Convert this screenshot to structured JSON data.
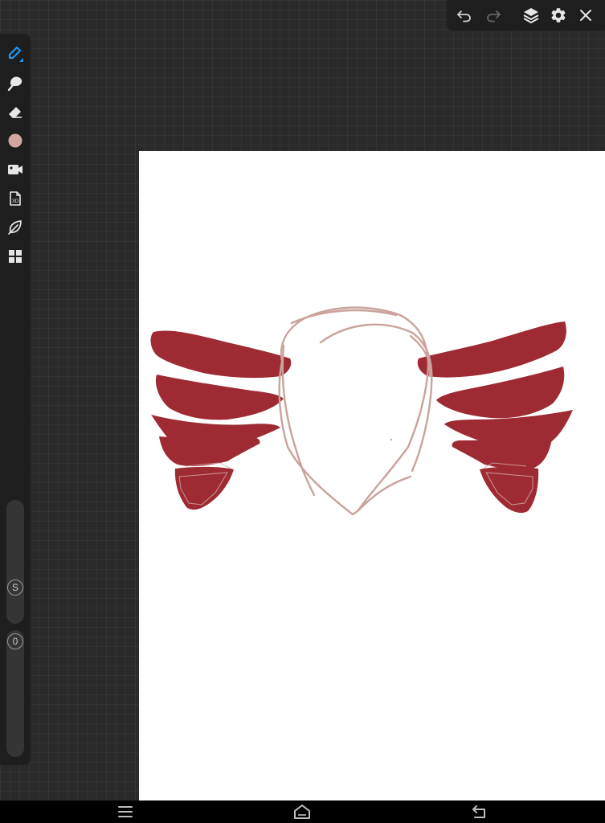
{
  "top_bar": {
    "buttons": [
      {
        "name": "undo-button",
        "icon": "undo-icon"
      },
      {
        "name": "redo-button",
        "icon": "redo-icon"
      },
      {
        "name": "layers-button",
        "icon": "layers-icon"
      },
      {
        "name": "settings-button",
        "icon": "gear-icon"
      },
      {
        "name": "close-button",
        "icon": "close-icon"
      }
    ]
  },
  "toolbar": {
    "active_tool": "brush",
    "accent_color": "#2196f3",
    "current_color": "#d4a6a0",
    "tools": [
      {
        "name": "brush",
        "icon": "brush-icon"
      },
      {
        "name": "smudge",
        "icon": "smudge-icon"
      },
      {
        "name": "eraser",
        "icon": "eraser-icon"
      },
      {
        "name": "color",
        "icon": "color-swatch-icon"
      },
      {
        "name": "record",
        "icon": "video-camera-icon"
      },
      {
        "name": "3d-model",
        "icon": "3d-file-icon"
      },
      {
        "name": "leaf",
        "icon": "leaf-icon"
      },
      {
        "name": "gallery",
        "icon": "grid-icon"
      }
    ],
    "size_slider": {
      "label": "S"
    },
    "opacity_slider": {
      "label": "0"
    }
  },
  "canvas": {
    "background": "#ffffff",
    "wing_color": "#9e2a33",
    "sketch_color": "#c9a39c"
  },
  "nav_bar": {
    "buttons": [
      {
        "name": "menu-button",
        "icon": "menu-icon"
      },
      {
        "name": "home-button",
        "icon": "home-icon"
      },
      {
        "name": "back-button",
        "icon": "back-icon"
      }
    ]
  }
}
